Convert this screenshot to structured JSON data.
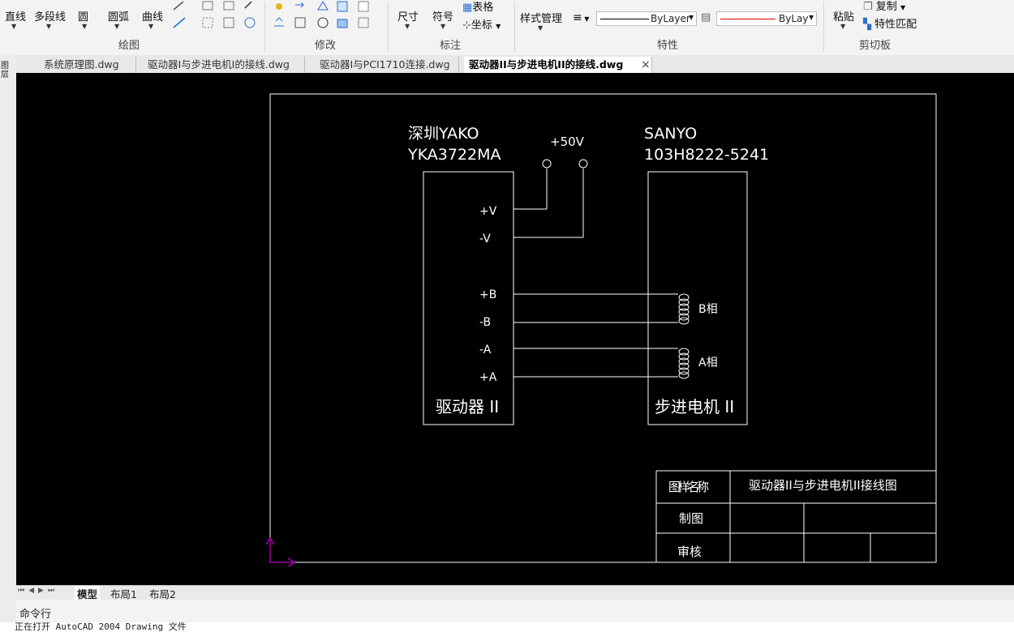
{
  "ribbon": {
    "draw": {
      "line": "直线",
      "polyline": "多段线",
      "circle": "圆",
      "arc": "圆弧",
      "curve": "曲线",
      "title": "绘图"
    },
    "modify": {
      "title": "修改"
    },
    "annotate": {
      "dimension": "尺寸",
      "symbol": "符号",
      "table": "表格",
      "coordinate": "坐标",
      "title": "标注"
    },
    "properties": {
      "style_mgr": "样式管理",
      "linetype": "ByLayer",
      "lineweight": "ByLay",
      "title": "特性"
    },
    "clipboard": {
      "paste": "粘贴",
      "copy": "复制",
      "match": "特性匹配",
      "title": "剪切板"
    }
  },
  "tabs": [
    {
      "label": "系统原理图.dwg"
    },
    {
      "label": "驱动器I与步进电机I的接线.dwg"
    },
    {
      "label": "驱动器I与PCI1710连接.dwg"
    },
    {
      "label": "驱动器II与步进电机II的接线.dwg",
      "active": true
    }
  ],
  "tab_close": "×",
  "left_tool": "图层",
  "drawing": {
    "driver_maker": "深圳YAKO",
    "driver_model": "YKA3722MA",
    "motor_maker": "SANYO",
    "motor_model": "103H8222-5241",
    "supply": "+50V",
    "pins": [
      "+V",
      "-V",
      "+B",
      "-B",
      "-A",
      "+A"
    ],
    "phase_b": "B相",
    "phase_a": "A相",
    "driver_label": "驱动器 II",
    "motor_label": "步进电机 II",
    "title_block": {
      "name_label": "图样名称",
      "name_value": "驱动器II与步进电机II接线图",
      "drawn_label": "制图",
      "review_label": "审核"
    }
  },
  "layout_tabs": {
    "model": "模型",
    "layout1": "布局1",
    "layout2": "布局2"
  },
  "command_label": "命令行",
  "status_text": "正在打开 AutoCAD 2004 Drawing 文件"
}
